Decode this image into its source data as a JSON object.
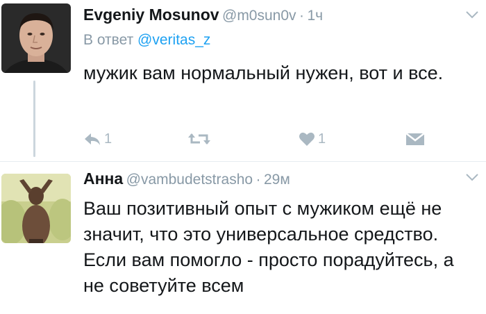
{
  "tweets": [
    {
      "author_name": "Evgeniy Mosunov",
      "handle": "@m0sun0v",
      "separator": "·",
      "time": "1ч",
      "reply_prefix": "В ответ",
      "reply_handle": "@veritas_z",
      "text": "мужик вам нормальный нужен, вот и все.",
      "actions": {
        "reply_count": "1",
        "like_count": "1"
      }
    },
    {
      "author_name": "Анна",
      "handle": "@vambudetstrasho",
      "separator": "·",
      "time": "29м",
      "text": "Ваш позитивный опыт с мужиком ещё не значит, что это универсальное средство. Если вам помогло - просто порадуйтесь, а не советуйте всем"
    }
  ],
  "icons": {
    "dropdown": "chevron-down-icon",
    "reply": "reply-icon",
    "retweet": "retweet-icon",
    "like": "heart-icon",
    "message": "envelope-icon"
  },
  "colors": {
    "name": "#14171a",
    "meta": "#8899a6",
    "link": "#1da1f2",
    "action": "#aab8c2",
    "thread_line": "#ccd6dd"
  }
}
